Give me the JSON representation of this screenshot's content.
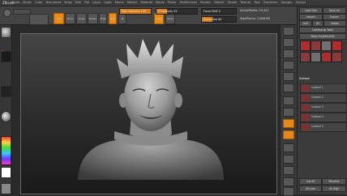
{
  "menubar": {
    "app_title": "ZBrush",
    "menus": [
      "Alpha",
      "Brush",
      "Color",
      "Document",
      "Draw",
      "Edit",
      "File",
      "Layer",
      "Light",
      "Macro",
      "Marker",
      "Material",
      "Movie",
      "Picker",
      "Preferences",
      "Render",
      "Stencil",
      "Stroke",
      "Texture",
      "Tool",
      "Transform",
      "Zplugin",
      "Zscript"
    ]
  },
  "toolbar": {
    "edit_label": "Edit",
    "move_label": "Move",
    "scale_label": "Scale",
    "rotate_label": "Rotate",
    "mrgb_label": "Mrgb",
    "rgb_label": "Rgb",
    "m_label": "M",
    "zadd_label": "Zadd",
    "zsub_label": "Zsub",
    "rgb_intensity": "Rgb Intensity 100",
    "z_intensity": "Z Intensity 25",
    "focal_shift": "Focal Shift 0",
    "draw_size": "Draw Size 64",
    "active_points": "ActivePoints: 15,411",
    "total_points": "TotalPoints: 2.846 Mil",
    "rgb_intensity_value": 1.0,
    "z_intensity_value": 0.25,
    "draw_size_value": 0.32,
    "accent_color": "#e88b1a"
  },
  "leftpanel": {
    "palette_colors": [
      "#ff3b3b",
      "#ffd23b",
      "#43d843",
      "#3bc6ff",
      "#6a3bff"
    ]
  },
  "rightpanel": {
    "header_load": "Load Tool",
    "header_save": "Save As",
    "import_label": "Import",
    "export_label": "Export",
    "goz_label": "GoZ",
    "all_label": "All",
    "visible_label": "Visible",
    "lightbox_label": "Lightbox ▶ Tools",
    "make_polymesh": "Make PolyMesh3D",
    "subtool_title": "Subtool",
    "subtools": [
      "Subtool 1",
      "Subtool 2",
      "Subtool 3",
      "Subtool 4",
      "Subtool 5"
    ],
    "list_all": "List All",
    "rename": "Rename",
    "all_low": "All Low",
    "all_high": "All High"
  },
  "icons": [
    "gear-icon",
    "move-icon",
    "scale-icon",
    "rotate-icon",
    "brush-icon",
    "stroke-icon",
    "alpha-icon",
    "texture-icon",
    "material-icon",
    "zoom-icon",
    "frame-icon",
    "xpose-icon",
    "transp-icon",
    "solo-icon"
  ]
}
